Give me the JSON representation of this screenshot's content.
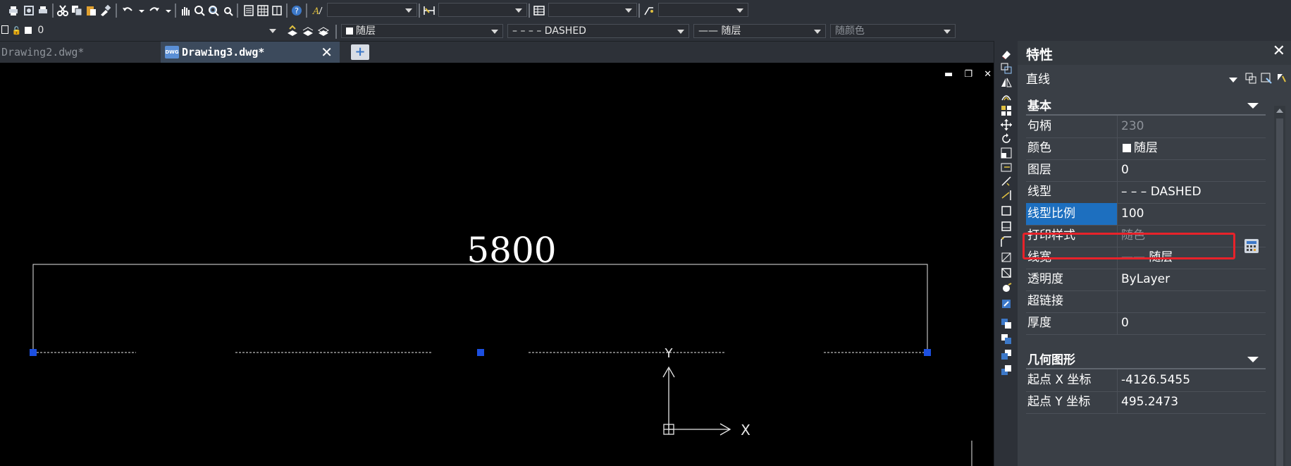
{
  "toolbar": {
    "text_style_value": "",
    "dim_style_value": "",
    "table_style_value": "",
    "multileader_style_value": ""
  },
  "layer_bar": {
    "current_layer": "0",
    "color": "随层",
    "linetype": "– – – – DASHED",
    "lineweight": "—— 随层",
    "plot_style": "随颜色"
  },
  "tabs": [
    {
      "label": "Drawing2.dwg*"
    },
    {
      "label": "Drawing3.dwg*"
    }
  ],
  "dwg_icon_text": "DWG",
  "close_glyph": "✕",
  "new_tab_glyph": "+",
  "canvas": {
    "dimension_text": "5800",
    "ucs_x": "X",
    "ucs_y": "Y",
    "window_controls": "▬ ❐ ✕"
  },
  "properties": {
    "title": "特性",
    "object_type": "直线",
    "sections": {
      "basic": "基本",
      "geometry": "几何图形"
    },
    "rows": [
      {
        "key": "句柄",
        "value": "230",
        "dim": true
      },
      {
        "key": "颜色",
        "value": "随层",
        "swatch": true
      },
      {
        "key": "图层",
        "value": "0"
      },
      {
        "key": "线型",
        "value": "– – – DASHED"
      },
      {
        "key": "线型比例",
        "value": "100",
        "selected": true
      },
      {
        "key": "打印样式",
        "value": "随色",
        "dim": true
      },
      {
        "key": "线宽",
        "value": "—— 随层"
      },
      {
        "key": "透明度",
        "value": "ByLayer"
      },
      {
        "key": "超链接",
        "value": ""
      },
      {
        "key": "厚度",
        "value": "0"
      }
    ],
    "geometry_rows": [
      {
        "key": "起点 X 坐标",
        "value": "-4126.5455"
      },
      {
        "key": "起点 Y 坐标",
        "value": "495.2473"
      }
    ]
  },
  "colors": {
    "accent": "#1d6fbf",
    "highlight": "#e8222a",
    "grip": "#1c4fe0"
  }
}
